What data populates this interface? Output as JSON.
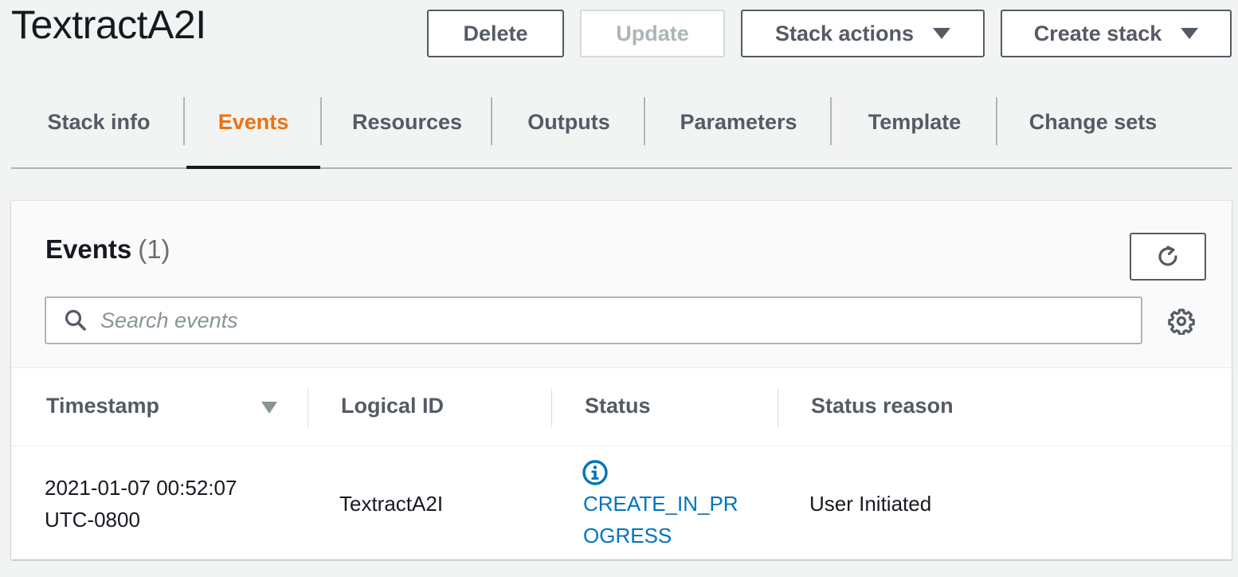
{
  "header": {
    "title": "TextractA2I",
    "buttons": {
      "delete": "Delete",
      "update": "Update",
      "stack_actions": "Stack actions",
      "create_stack": "Create stack"
    }
  },
  "tabs": [
    {
      "label": "Stack info"
    },
    {
      "label": "Events"
    },
    {
      "label": "Resources"
    },
    {
      "label": "Outputs"
    },
    {
      "label": "Parameters"
    },
    {
      "label": "Template"
    },
    {
      "label": "Change sets"
    }
  ],
  "active_tab": "Events",
  "events_panel": {
    "title": "Events",
    "count": "(1)",
    "search_placeholder": "Search events",
    "columns": [
      "Timestamp",
      "Logical ID",
      "Status",
      "Status reason"
    ],
    "rows": [
      {
        "timestamp_line1": "2021-01-07 00:52:07",
        "timestamp_line2": "UTC-0800",
        "logical_id": "TextractA2I",
        "status_line1": "CREATE_IN_PR",
        "status_line2": "OGRESS",
        "status_reason": "User Initiated"
      }
    ]
  },
  "colors": {
    "accent_active_tab": "#ec7211",
    "link_status": "#0073bb",
    "button_border": "#545b64"
  },
  "icons": {
    "dropdown": "caret-down-icon",
    "refresh": "refresh-icon",
    "search": "search-icon",
    "settings": "gear-icon",
    "info": "info-icon",
    "sort": "sort-descending-icon"
  }
}
